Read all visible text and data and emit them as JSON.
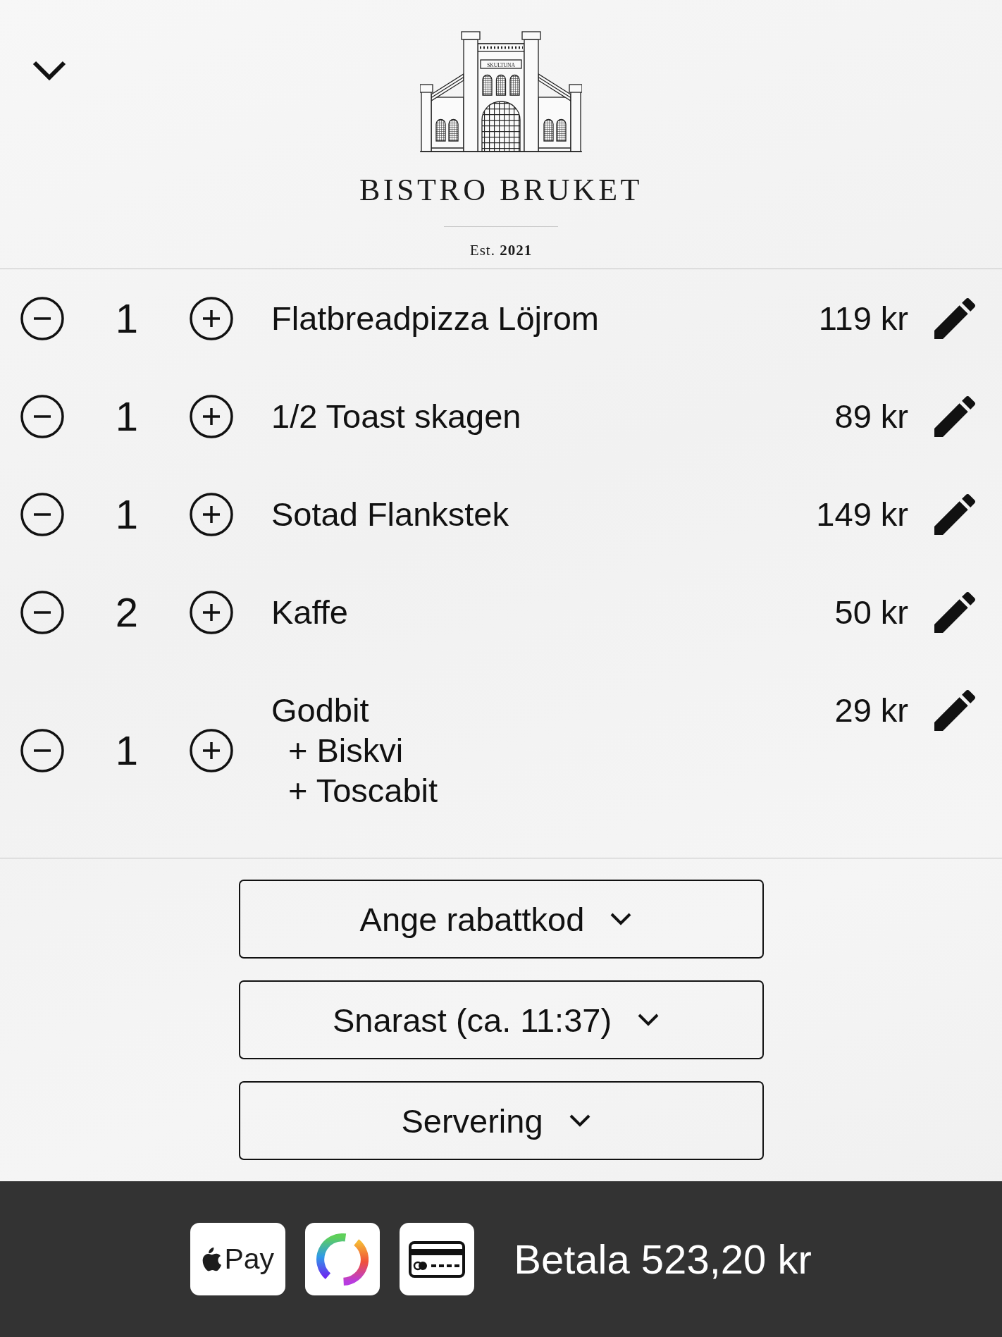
{
  "header": {
    "logo_sign": "SKULTUNA",
    "title": "BISTRO BRUKET",
    "established": "Est. **2021**"
  },
  "order_items": [
    {
      "quantity": "1",
      "name": "Flatbreadpizza Löjrom",
      "price": "119 kr"
    },
    {
      "quantity": "1",
      "name": "1/2 Toast skagen",
      "price": "89 kr"
    },
    {
      "quantity": "1",
      "name": "Sotad Flankstek",
      "price": "149 kr"
    },
    {
      "quantity": "2",
      "name": "Kaffe",
      "price": "50 kr"
    },
    {
      "quantity": "1",
      "name": "Godbit",
      "extras": [
        "+ Biskvi",
        "+ Toscabit"
      ],
      "price": "29 kr"
    }
  ],
  "options": [
    {
      "label": "Ange rabattkod"
    },
    {
      "label": "Snarast (ca. 11:37)"
    },
    {
      "label": "Servering"
    }
  ],
  "payment_bar": {
    "methods": [
      {
        "kind": "apple_pay",
        "label": "Pay"
      },
      {
        "kind": "swish"
      },
      {
        "kind": "card"
      }
    ],
    "pay_button": "Betala 523,20 kr"
  }
}
